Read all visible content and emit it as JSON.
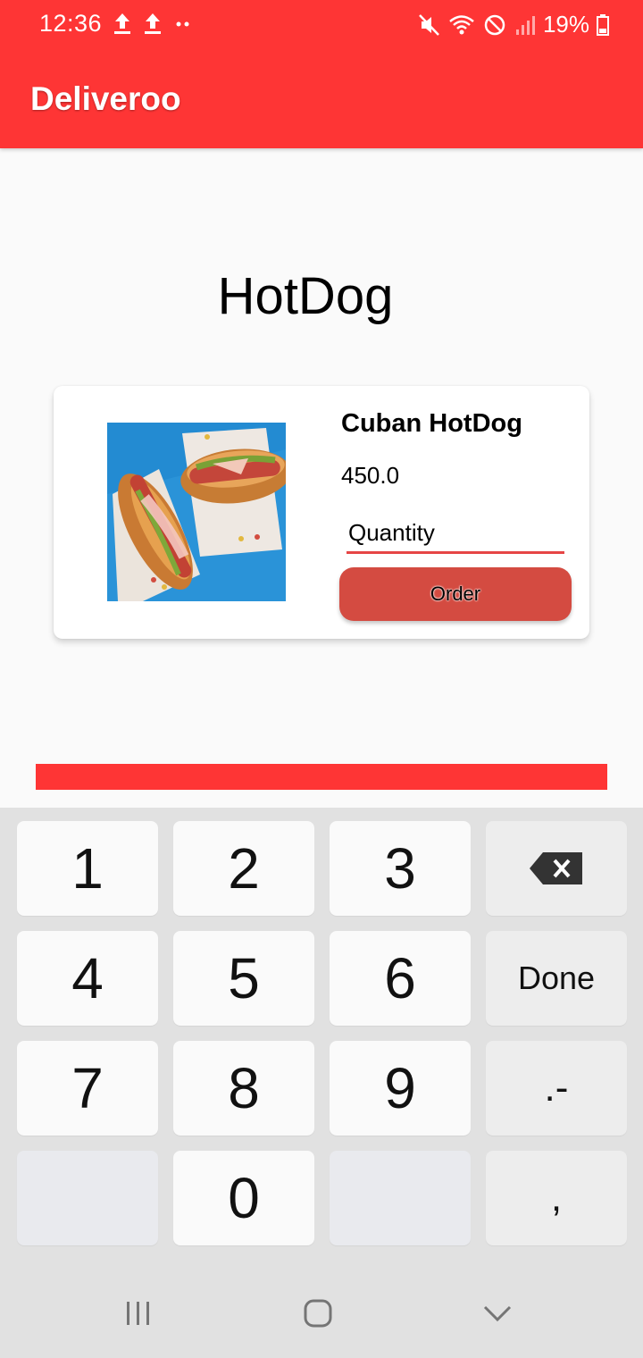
{
  "status_bar": {
    "time": "12:36",
    "battery": "19%",
    "left_icons": [
      "upload-icon",
      "upload-icon",
      "dots-icon"
    ],
    "right_icons": [
      "mute-icon",
      "wifi-icon",
      "dnd-icon",
      "signal-icon",
      "battery-icon"
    ]
  },
  "app_bar": {
    "title": "Deliveroo"
  },
  "page": {
    "heading": "HotDog"
  },
  "card": {
    "name": "Cuban HotDog",
    "price": "450.0",
    "quantity_placeholder": "Quantity",
    "order_label": "Order"
  },
  "keyboard": {
    "keys": [
      "1",
      "2",
      "3",
      "",
      "4",
      "5",
      "6",
      "Done",
      "7",
      "8",
      "9",
      ".-",
      "",
      "0",
      "",
      ","
    ]
  },
  "nav": {
    "buttons": [
      "recents-icon",
      "home-icon",
      "back-icon"
    ]
  },
  "colors": {
    "accent": "#fe3535",
    "button": "#d44b41",
    "background": "#fafafa"
  }
}
